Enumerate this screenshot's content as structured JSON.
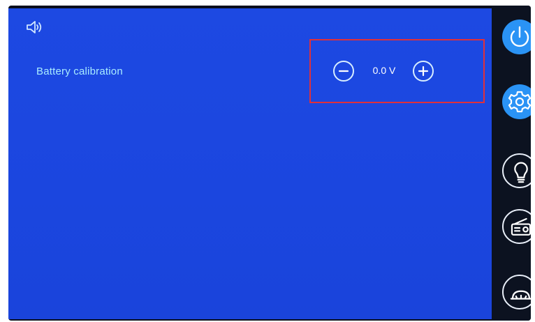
{
  "screen": {
    "speaker_icon": "speaker-icon",
    "setting": {
      "label": "Battery calibration"
    },
    "stepper": {
      "value": "0.0 V",
      "decrease_icon": "minus-circle-icon",
      "increase_icon": "plus-circle-icon"
    }
  },
  "rail": {
    "items": [
      {
        "icon": "power-icon"
      },
      {
        "icon": "gear-icon"
      },
      {
        "icon": "lightbulb-icon"
      },
      {
        "icon": "radio-icon"
      },
      {
        "icon": "device-icon"
      }
    ]
  },
  "colors": {
    "screen_bg": "#1b46df",
    "label_text": "#a9ecff",
    "highlight_border": "#e0303a",
    "rail_active": "#2a93f5",
    "rail_bg": "#0c1220"
  }
}
